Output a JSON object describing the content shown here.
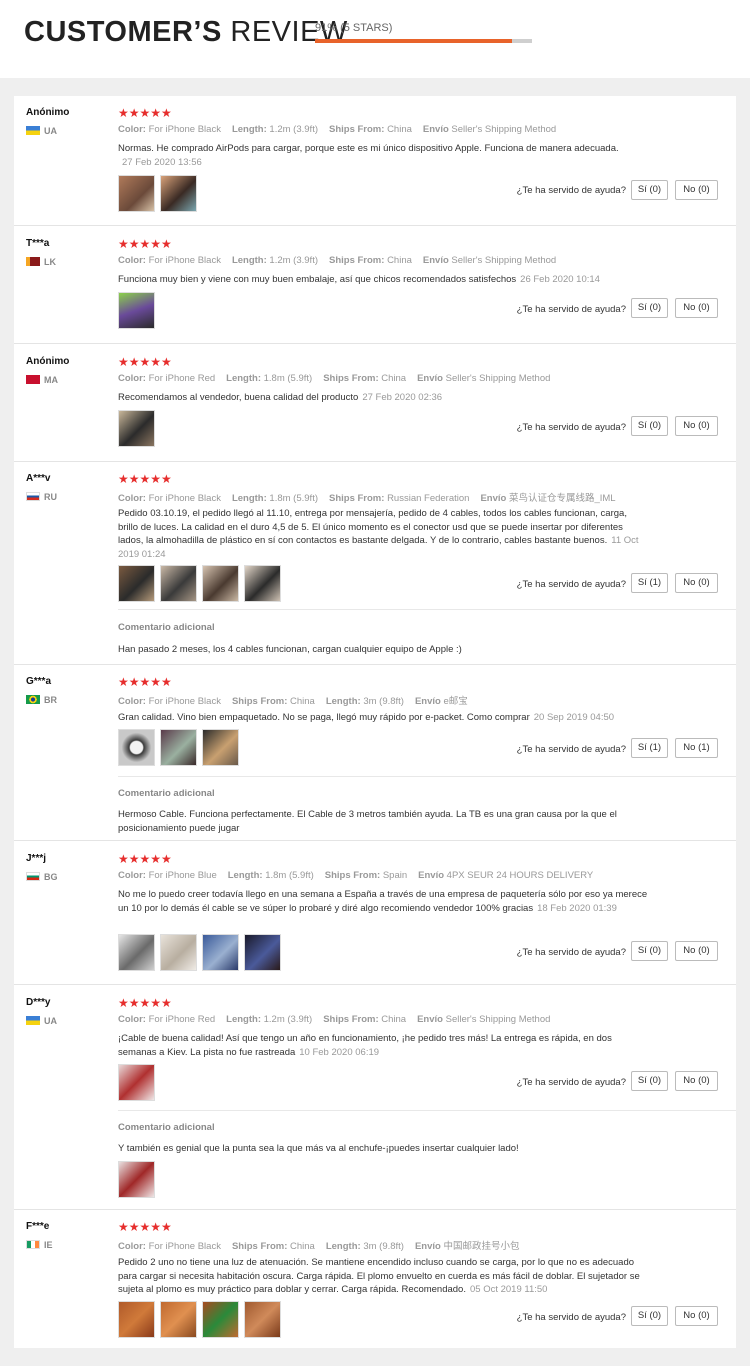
{
  "header": {
    "title_bold": "CUSTOMER’S",
    "title_light": "REVIEW",
    "rating_text": "91% (5 STARS)",
    "rating_fraction": 0.91
  },
  "labels": {
    "color": "Color:",
    "length": "Length:",
    "ships_from": "Ships From:",
    "envio": "Envío",
    "helpful": "¿Te ha servido de ayuda?",
    "additional": "Comentario adicional"
  },
  "stars_glyph": "★★★★★",
  "reviews": [
    {
      "user": "Anónimo",
      "country": "UA",
      "flag": "ua",
      "color": "For iPhone Black",
      "length": "1.2m (3.9ft)",
      "ships": "China",
      "envio": "Seller's Shipping Method",
      "text": "Normas. He comprado AirPods para cargar, porque este es mi único dispositivo Apple. Funciona de manera adecuada.",
      "date": "27 Feb 2020 13:56",
      "yes": "Sí (0)",
      "no": "No (0)"
    },
    {
      "user": "T***a",
      "country": "LK",
      "flag": "lk",
      "color": "For iPhone Black",
      "length": "1.2m (3.9ft)",
      "ships": "China",
      "envio": "Seller's Shipping Method",
      "text": "Funciona muy bien y viene con muy buen embalaje, así que chicos recomendados satisfechos",
      "date": "26 Feb 2020 10:14",
      "yes": "Sí (0)",
      "no": "No (0)"
    },
    {
      "user": "Anónimo",
      "country": "MA",
      "flag": "ma",
      "color": "For iPhone Red",
      "length": "1.8m (5.9ft)",
      "ships": "China",
      "envio": "Seller's Shipping Method",
      "text": "Recomendamos al vendedor, buena calidad del producto",
      "date": "27 Feb 2020 02:36",
      "yes": "Sí (0)",
      "no": "No (0)"
    },
    {
      "user": "A***v",
      "country": "RU",
      "flag": "ru",
      "color": "For iPhone Black",
      "length": "1.8m (5.9ft)",
      "ships": "Russian Federation",
      "envio": "菜鸟认证仓专属线路_IML",
      "text": "Pedido 03.10.19, el pedido llegó al 11.10, entrega por mensajería, pedido de 4 cables, todos los cables funcionan, carga, brillo de luces. La calidad en el duro 4,5 de 5. El único momento es el conector usd que se puede insertar por diferentes lados, la almohadilla de plástico en sí con contactos es bastante delgada. Y de lo contrario, cables bastante buenos.",
      "date": "11 Oct 2019 01:24",
      "yes": "Sí (1)",
      "no": "No (0)",
      "additional": "Han pasado 2 meses, los 4 cables funcionan, cargan cualquier equipo de Apple :)"
    },
    {
      "user": "G***a",
      "country": "BR",
      "flag": "br",
      "color": "For iPhone Black",
      "ships": "China",
      "length": "3m (9.8ft)",
      "envio": "e邮宝",
      "text": "Gran calidad. Vino bien empaquetado. No se paga, llegó muy rápido por e-packet. Como comprar",
      "date": "20 Sep 2019 04:50",
      "yes": "Sí (1)",
      "no": "No (1)",
      "additional": "Hermoso Cable. Funciona perfectamente. El Cable de 3 metros también ayuda. La TB es una gran causa por la que el posicionamiento puede jugar"
    },
    {
      "user": "J***j",
      "country": "BG",
      "flag": "bg",
      "color": "For iPhone Blue",
      "length": "1.8m (5.9ft)",
      "ships": "Spain",
      "envio": "4PX SEUR 24 HOURS DELIVERY",
      "text": "No me lo puedo creer todavía llego en una semana a España a través de una empresa de paquetería sólo por eso ya merece un 10 por lo demás él cable se ve súper lo probaré y diré algo recomiendo vendedor 100% gracias",
      "date": "18 Feb 2020 01:39",
      "yes": "Sí (0)",
      "no": "No (0)"
    },
    {
      "user": "D***y",
      "country": "UA",
      "flag": "ua",
      "color": "For iPhone Red",
      "length": "1.2m (3.9ft)",
      "ships": "China",
      "envio": "Seller's Shipping Method",
      "text": "¡Cable de buena calidad! Así que tengo un año en funcionamiento, ¡he pedido tres más! La entrega es rápida, en dos semanas a Kiev. La pista no fue rastreada",
      "date": "10 Feb 2020 06:19",
      "yes": "Sí (0)",
      "no": "No (0)",
      "additional": "Y también es genial que la punta sea la que más va al enchufe-¡puedes insertar cualquier lado!"
    },
    {
      "user": "F***e",
      "country": "IE",
      "flag": "ie",
      "color": "For iPhone Black",
      "ships": "China",
      "length": "3m (9.8ft)",
      "envio": "中国邮政挂号小包",
      "text": "Pedido 2 uno no tiene una luz de atenuación. Se mantiene encendido incluso cuando se carga, por lo que no es adecuado para cargar si necesita habitación oscura. Carga rápida. El plomo envuelto en cuerda es más fácil de doblar. El sujetador se sujeta al plomo es muy práctico para doblar y cerrar. Carga rápida. Recomendado.",
      "date": "05 Oct 2019 11:50",
      "yes": "Sí (0)",
      "no": "No (0)"
    }
  ]
}
